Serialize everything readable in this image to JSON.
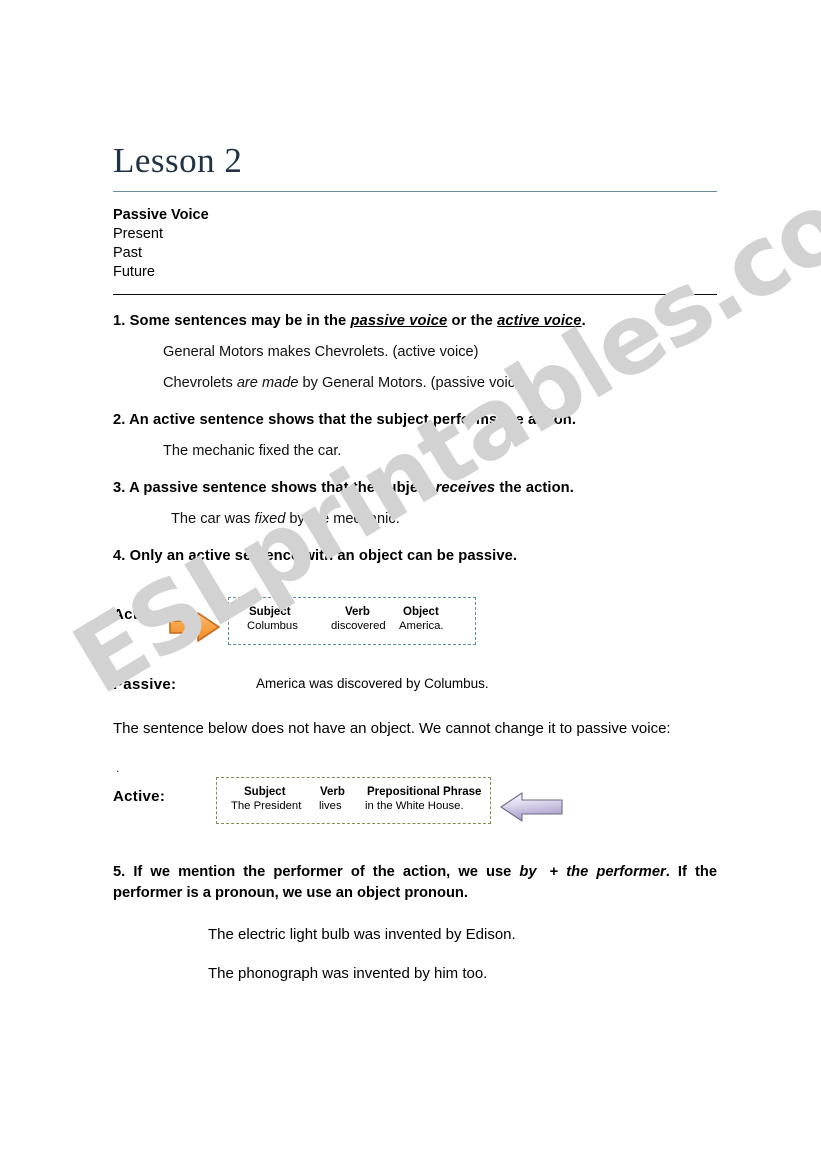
{
  "watermark": {
    "text": "ESLprintables.com",
    "color": "#d2d2d2"
  },
  "title": "Lesson 2",
  "subhead": {
    "heading": "Passive Voice",
    "tense_1": "Present",
    "tense_2": "Past",
    "tense_3": "Future"
  },
  "rules": {
    "r1": {
      "num": "1. Some sentences may be in the ",
      "term_a": "passive voice",
      "mid": " or the  ",
      "term_b": "active voice",
      "end": ".",
      "ex1": "General Motors makes  Chevrolets. (active voice)",
      "ex2_a": "Chevrolets ",
      "ex2_it": "are made",
      "ex2_b": " by General Motors. (passive voice)"
    },
    "r2": {
      "text": "2. An active sentence shows that the subject performs the action.",
      "ex1": "The mechanic fixed the car."
    },
    "r3": {
      "a": "3.  A passive sentence shows that the subject ",
      "it": "receives",
      "b": " the action.",
      "ex1_a": "The car was  ",
      "ex1_it": "fixed",
      "ex1_b": "  by the mechanic."
    },
    "r4": {
      "text": "4. Only an active sentence with an object can be passive."
    },
    "r5": {
      "a": "5. If we mention the performer of the action, we use ",
      "it_by": "by",
      "plus": "+ ",
      "it_performer": "the performer",
      "b": ".  If the performer is a pronoun, we use an object pronoun.",
      "ex1": "The electric light bulb was invented by Edison.",
      "ex2": "The phonograph was invented by him too."
    }
  },
  "diagram1": {
    "label": "Active:",
    "border_color": "#5f8fa8",
    "arrow_color": "#f2912e",
    "cells": [
      {
        "head": "Subject",
        "value": "Columbus"
      },
      {
        "head": "Verb",
        "value": "discovered"
      },
      {
        "head": "Object",
        "value": "America."
      }
    ]
  },
  "passive_row": {
    "label": "Passive:",
    "sentence": "America was discovered by Columbus."
  },
  "note_paragraph": "The sentence below does not have an object. We cannot change it to passive voice:",
  "diagram2": {
    "label": "Active:",
    "stray_mark": ".",
    "border_color": "#8a8a4e",
    "arrow_color": "#b9aed6",
    "cells": [
      {
        "head": "Subject",
        "value": "The President"
      },
      {
        "head": "Verb",
        "value": "lives"
      },
      {
        "head": "Prepositional Phrase",
        "value": "in the White House."
      }
    ]
  }
}
